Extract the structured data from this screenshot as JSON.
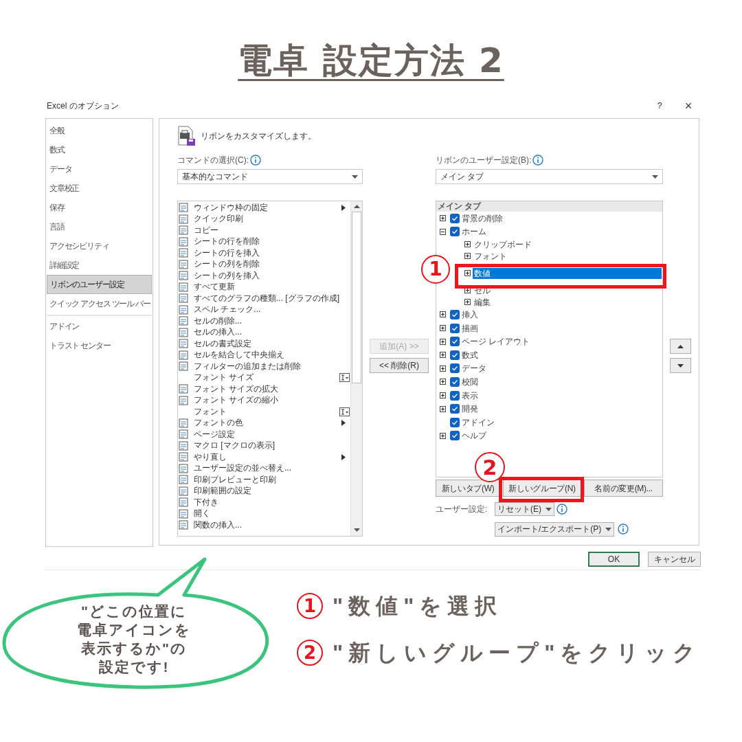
{
  "title": "電卓 設定方法 2",
  "window": {
    "title": "Excel のオプション",
    "help": "?",
    "close": "×"
  },
  "sidebar": {
    "groups": [
      [
        {
          "label": "全般",
          "selected": false
        },
        {
          "label": "数式",
          "selected": false
        },
        {
          "label": "データ",
          "selected": false
        },
        {
          "label": "文章校正",
          "selected": false
        },
        {
          "label": "保存",
          "selected": false
        },
        {
          "label": "言語",
          "selected": false
        },
        {
          "label": "アクセシビリティ",
          "selected": false
        },
        {
          "label": "詳細設定",
          "selected": false
        },
        {
          "label": "リボンのユーザー設定",
          "selected": true
        },
        {
          "label": "クイック アクセス ツール バー",
          "selected": false
        }
      ],
      [
        {
          "label": "アドイン",
          "selected": false
        },
        {
          "label": "トラスト センター",
          "selected": false
        }
      ]
    ]
  },
  "header": "リボンをカスタマイズします。",
  "commands": {
    "label": "コマンドの選択(C):",
    "dropdown": "基本的なコマンド",
    "items": [
      {
        "label": "ウィンドウ枠の固定",
        "kind": "submenu"
      },
      {
        "label": "クイック印刷",
        "kind": "plain"
      },
      {
        "label": "コピー",
        "kind": "plain"
      },
      {
        "label": "シートの行を削除",
        "kind": "plain"
      },
      {
        "label": "シートの行を挿入",
        "kind": "plain"
      },
      {
        "label": "シートの列を削除",
        "kind": "plain"
      },
      {
        "label": "シートの列を挿入",
        "kind": "plain"
      },
      {
        "label": "すべて更新",
        "kind": "plain"
      },
      {
        "label": "すべてのグラフの種類... [グラフの作成]",
        "kind": "plain"
      },
      {
        "label": "スペル チェック...",
        "kind": "plain"
      },
      {
        "label": "セルの削除...",
        "kind": "plain"
      },
      {
        "label": "セルの挿入...",
        "kind": "plain"
      },
      {
        "label": "セルの書式設定",
        "kind": "plain"
      },
      {
        "label": "セルを結合して中央揃え",
        "kind": "plain"
      },
      {
        "label": "フィルターの追加または削除",
        "kind": "plain"
      },
      {
        "label": "フォント サイズ",
        "kind": "dropdown"
      },
      {
        "label": "フォント サイズの拡大",
        "kind": "plain"
      },
      {
        "label": "フォント サイズの縮小",
        "kind": "plain"
      },
      {
        "label": "フォント",
        "kind": "dropdown"
      },
      {
        "label": "フォントの色",
        "kind": "submenu"
      },
      {
        "label": "ページ設定",
        "kind": "plain"
      },
      {
        "label": "マクロ [マクロの表示]",
        "kind": "plain"
      },
      {
        "label": "やり直し",
        "kind": "submenu"
      },
      {
        "label": "ユーザー設定の並べ替え...",
        "kind": "plain"
      },
      {
        "label": "印刷プレビューと印刷",
        "kind": "plain"
      },
      {
        "label": "印刷範囲の設定",
        "kind": "plain"
      },
      {
        "label": "下付き",
        "kind": "plain"
      },
      {
        "label": "開く",
        "kind": "plain"
      },
      {
        "label": "関数の挿入...",
        "kind": "plain"
      }
    ]
  },
  "add_button": {
    "label": "追加(A) >>",
    "disabled": true
  },
  "remove_button": {
    "label": "<< 削除(R)",
    "disabled": false
  },
  "ribbon": {
    "label": "リボンのユーザー設定(B):",
    "dropdown": "メイン タブ",
    "tree_header": "メイン タブ",
    "tabs": [
      {
        "label": "背景の削除",
        "checked": true,
        "kind": "collapsed"
      },
      {
        "label": "ホーム",
        "checked": true,
        "kind": "expanded",
        "children": [
          {
            "label": "クリップボード",
            "selected": false
          },
          {
            "label": "フォント",
            "selected": false
          },
          {
            "label": "数値",
            "selected": true
          },
          {
            "label": "セル",
            "selected": false
          },
          {
            "label": "編集",
            "selected": false
          }
        ]
      },
      {
        "label": "挿入",
        "checked": true,
        "kind": "collapsed"
      },
      {
        "label": "描画",
        "checked": true,
        "kind": "collapsed"
      },
      {
        "label": "ページ レイアウト",
        "checked": true,
        "kind": "collapsed"
      },
      {
        "label": "数式",
        "checked": true,
        "kind": "collapsed"
      },
      {
        "label": "データ",
        "checked": true,
        "kind": "collapsed"
      },
      {
        "label": "校閲",
        "checked": true,
        "kind": "collapsed"
      },
      {
        "label": "表示",
        "checked": true,
        "kind": "collapsed"
      },
      {
        "label": "開発",
        "checked": true,
        "kind": "collapsed"
      },
      {
        "label": "アドイン",
        "checked": true,
        "kind": "plain"
      },
      {
        "label": "ヘルプ",
        "checked": true,
        "kind": "collapsed"
      }
    ],
    "buttons": [
      "新しいタブ(W)",
      "新しいグループ(N)",
      "名前の変更(M)..."
    ],
    "user_settings_label": "ユーザー設定:",
    "reset": "リセット(E)",
    "import_export": "インポート/エクスポート(P)"
  },
  "dialog_buttons": [
    {
      "label": "OK",
      "default": true
    },
    {
      "label": "キャンセル",
      "default": false
    }
  ],
  "annotations": [
    "1",
    "2"
  ],
  "callout": [
    "\"どこの位置に",
    "電卓アイコンを",
    "表示するか\"の",
    "設定です!"
  ],
  "steps": [
    {
      "number": "1",
      "text": "\"数値\"を選択"
    },
    {
      "number": "2",
      "text": "\"新しいグループ\"をクリック"
    }
  ]
}
